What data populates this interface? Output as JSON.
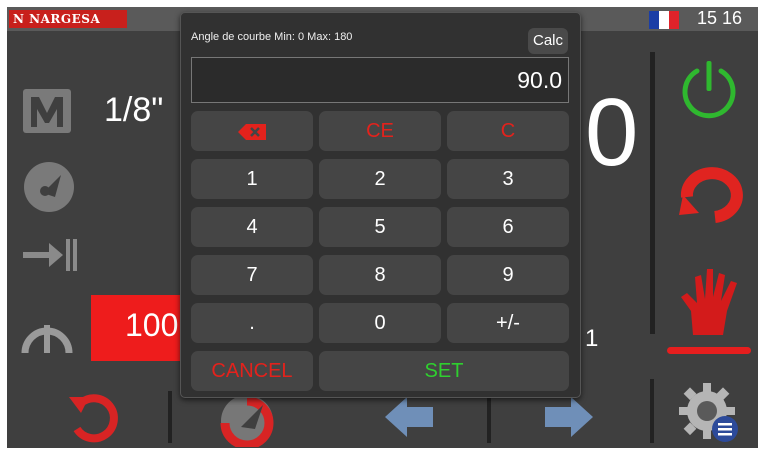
{
  "header": {
    "brand": "N NARGESA",
    "time": "15 16",
    "flag_colors": [
      "#1b3ea6",
      "#ffffff",
      "#e0232a"
    ]
  },
  "background": {
    "mode_value": "1/8\"",
    "big_value": "0",
    "red_field_value": "100",
    "small_value": "1"
  },
  "icons": {
    "left": [
      "manual-mode-icon",
      "gauge-icon",
      "stop-to-limit-icon",
      "arc-bend-icon"
    ],
    "right": [
      "power-icon",
      "cycle-icon",
      "hand-stop-icon"
    ],
    "bottom": [
      "rotate-left-icon",
      "bend-cycle-icon",
      "arrow-left-icon",
      "arrow-right-icon",
      "settings-icon"
    ],
    "colors": {
      "power": "#2fb82f",
      "cycle": "#e02420",
      "hand": "#d31b1b"
    }
  },
  "dialog": {
    "title": "Angle de courbe Min: 0 Max: 180",
    "calc_label": "Calc",
    "value": "90.0",
    "keys": {
      "clear_entry": "CE",
      "clear": "C",
      "k1": "1",
      "k2": "2",
      "k3": "3",
      "k4": "4",
      "k5": "5",
      "k6": "6",
      "k7": "7",
      "k8": "8",
      "k9": "9",
      "dot": ".",
      "k0": "0",
      "sign": "+/-",
      "cancel": "CANCEL",
      "set": "SET"
    }
  }
}
